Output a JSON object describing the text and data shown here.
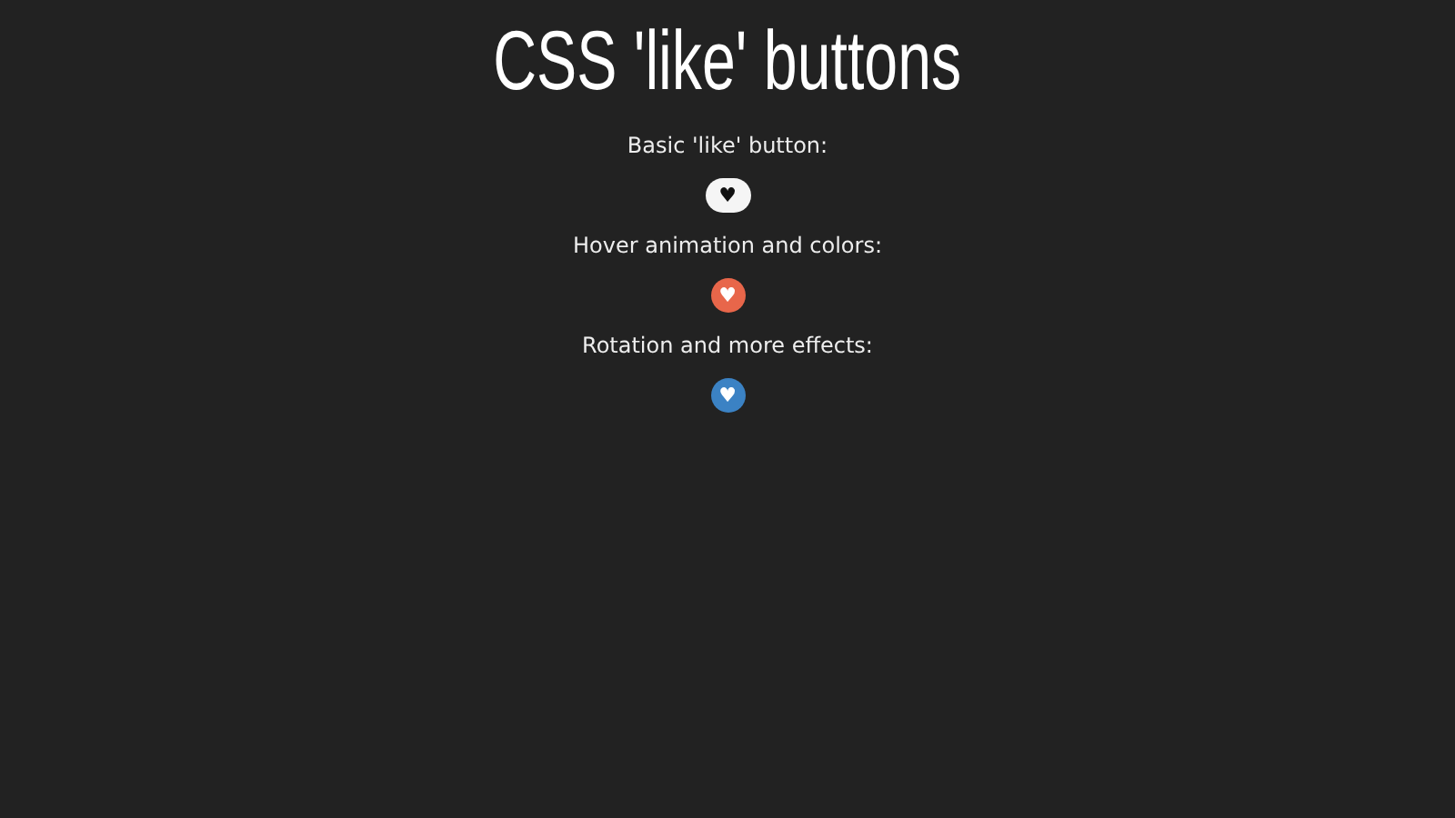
{
  "title": "CSS 'like' buttons",
  "demos": [
    {
      "label": "Basic 'like' button:",
      "button": {
        "text": "♥",
        "kind": "pill",
        "color": "#f5f5f5"
      }
    },
    {
      "label": "Hover animation and colors:",
      "button": {
        "text": "♥",
        "kind": "circle",
        "color": "#e8664a"
      }
    },
    {
      "label": "Rotation and more effects:",
      "button": {
        "text": "♥",
        "kind": "circle",
        "color": "#3b82c4"
      }
    }
  ]
}
